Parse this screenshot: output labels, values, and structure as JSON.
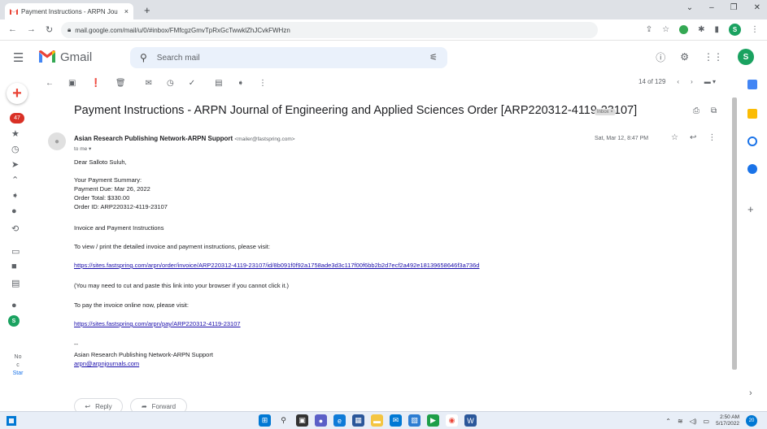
{
  "browser": {
    "tab_title": "Payment Instructions - ARPN Jou",
    "tab_close": "×",
    "new_tab": "+",
    "url": "mail.google.com/mail/u/0/#inbox/FMfcgzGmvTpRxGcTwwklZhJCvkFWHzn",
    "window_controls": [
      "⌄",
      "–",
      "❐",
      "✕"
    ],
    "profile_initial": "S"
  },
  "gmail": {
    "app_name": "Gmail",
    "search_placeholder": "Search mail",
    "account_initial": "S",
    "unread_badge": "47"
  },
  "message_toolbar": {
    "pager": "14 of 129"
  },
  "message": {
    "subject": "Payment Instructions - ARPN Journal of Engineering and Applied Sciences Order [ARP220312-4119-23107]",
    "label_chip": "Inbox ×",
    "sender_name": "Asian Research Publishing Network-ARPN Support",
    "sender_email": "<mailer@fastspring.com>",
    "to": "to me ▾",
    "date": "Sat, Mar 12, 8:47 PM",
    "greeting": "Dear Salloto Suluh,",
    "summary_heading": "Your Payment Summary:",
    "payment_due": "Payment Due: Mar 26, 2022",
    "order_total": "Order Total: $330.00",
    "order_id": "Order ID: ARP220312-4119-23107",
    "invoice_heading": "Invoice and Payment Instructions",
    "view_instructions": "To view / print the detailed invoice and payment instructions, please visit:",
    "invoice_link": "https://sites.fastspring.com/arpn/order/invoice/ARP220312-4119-23107/id/8b091f0f92a1758ade3d3c117f00f6bb2b2d7ecf2a492e18139658646f3a736d",
    "copy_note": "(You may need to cut and paste this link into your browser if you cannot click it.)",
    "pay_online": "To pay the invoice online now, please visit:",
    "pay_link": "https://sites.fastspring.com/arpn/pay/ARP220312-4119-23107",
    "sig_dash": "--",
    "sig_name": "Asian Research Publishing Network-ARPN Support",
    "sig_email": "arpn@arpnjournals.com"
  },
  "actions": {
    "reply": "Reply",
    "forward": "Forward"
  },
  "rail": {
    "text_line1": "No",
    "text_line2": "c",
    "text_line3": "Star"
  },
  "taskbar": {
    "time": "2:50 AM",
    "date": "5/17/2022",
    "notifications": "20"
  }
}
